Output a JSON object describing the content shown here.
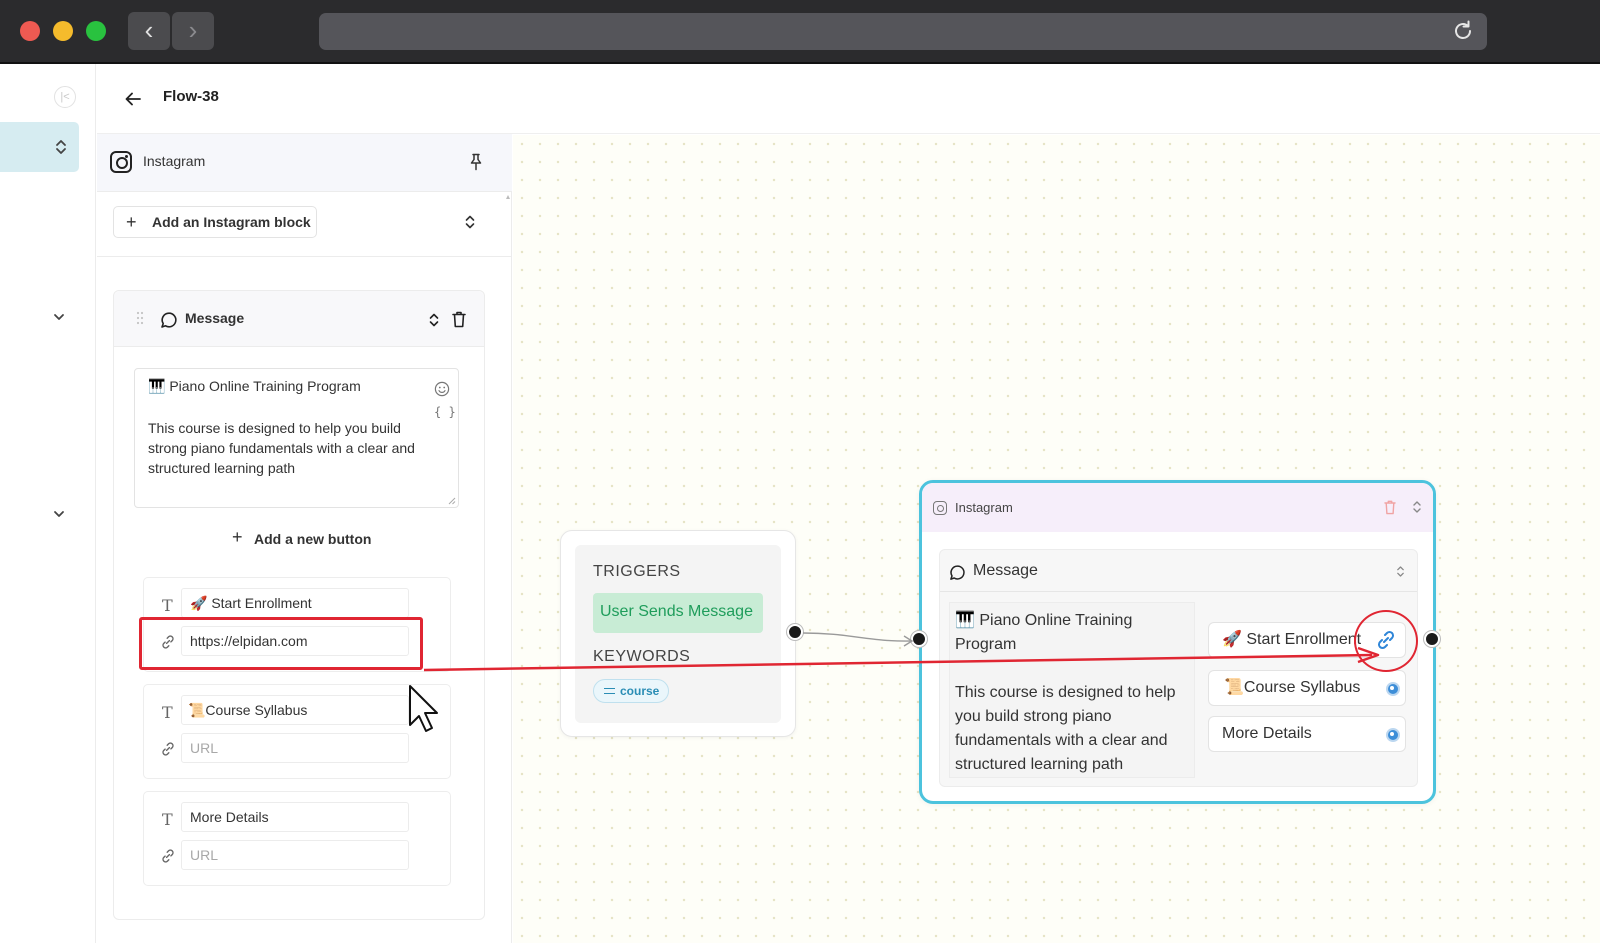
{
  "browser": {
    "traffic_lights": [
      "#ee5a52",
      "#f5bb2c",
      "#29c23f"
    ],
    "back_glyph": "‹",
    "forward_glyph": "›"
  },
  "header": {
    "title": "Flow-38"
  },
  "panel": {
    "title": "Instagram",
    "add_block_label": "Add an Instagram block",
    "message_block": {
      "title": "Message",
      "text_title": "🎹 Piano Online Training Program",
      "text_body": "This course is designed to help you build strong piano fundamentals with a clear and structured learning path",
      "vars_glyph": "{ }",
      "add_button_label": "Add a new button",
      "buttons": [
        {
          "label": "🚀 Start Enrollment",
          "url": "https://elpidan.com",
          "url_placeholder": "URL"
        },
        {
          "label": "📜Course Syllabus",
          "url": "",
          "url_placeholder": "URL"
        },
        {
          "label": "More Details",
          "url": "",
          "url_placeholder": "URL"
        }
      ]
    }
  },
  "canvas": {
    "trigger_node": {
      "triggers_label": "TRIGGERS",
      "event": "User Sends Message",
      "keywords_label": "KEYWORDS",
      "keyword": "course"
    },
    "instagram_node": {
      "title": "Instagram",
      "message_title": "Message",
      "text_title": "🎹 Piano Online Training Program",
      "text_body": "This course is designed to help you build strong piano fundamentals with a clear and structured learning path",
      "buttons": [
        {
          "label": "🚀 Start Enrollment",
          "status": "linked"
        },
        {
          "label": "📜Course Syllabus",
          "status": "unlinked"
        },
        {
          "label": "More Details",
          "status": "unlinked"
        }
      ]
    }
  },
  "colors": {
    "accent_cyan": "#4cc3dd",
    "annotation_red": "#e02632",
    "trigger_green": "#1f9d5b",
    "keyword_blue": "#2a8db5"
  }
}
